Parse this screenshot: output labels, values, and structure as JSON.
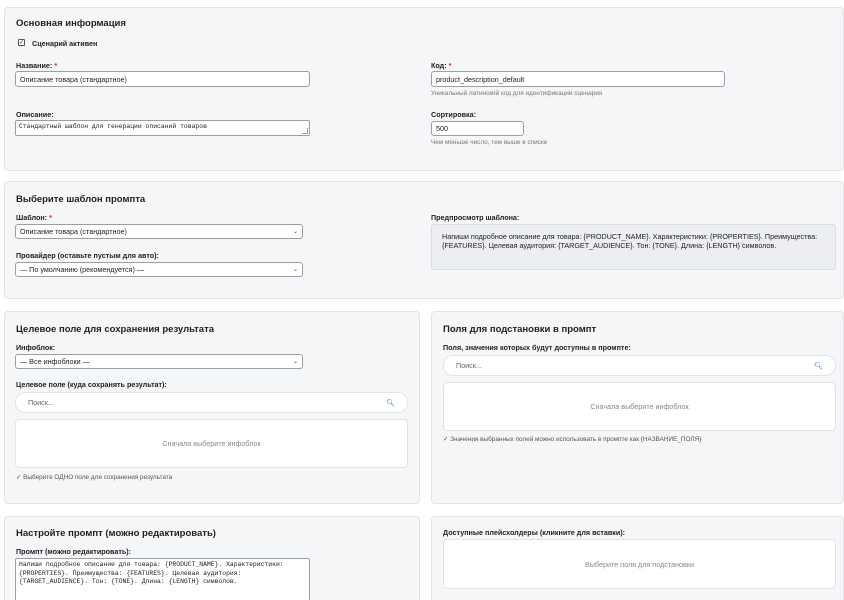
{
  "basic": {
    "title": "Основная информация",
    "active_checkbox": {
      "label": "Сценарий активен",
      "checked": true
    },
    "name": {
      "label": "Название:",
      "required": "*",
      "value": "Описание товара (стандартное)"
    },
    "code": {
      "label": "Код:",
      "required": "*",
      "value": "product_description_default",
      "hint": "Уникальный латинский код для идентификации сценария"
    },
    "description": {
      "label": "Описание:",
      "value": "Стандартный шаблон для генерации описаний товаров"
    },
    "sort": {
      "label": "Сортировка:",
      "value": "500",
      "hint": "Чем меньше число, тем выше в списке"
    }
  },
  "template": {
    "title": "Выберите шаблон промпта",
    "template_select": {
      "label": "Шаблон:",
      "required": "*",
      "value": "Описание товара (стандартное)"
    },
    "provider_select": {
      "label": "Провайдер (оставьте пустым для авто):",
      "value": "— По умолчанию (рекомендуется) —"
    },
    "preview": {
      "label": "Предпросмотр шаблона:",
      "text": "Напиши подробное описание для товара: {PRODUCT_NAME}. Характеристики: {PROPERTIES}. Преимущества: {FEATURES}. Целевая аудитория: {TARGET_AUDIENCE}. Тон: {TONE}. Длина: {LENGTH} символов."
    }
  },
  "target": {
    "title": "Целевое поле для сохранения результата",
    "iblock_select": {
      "label": "Инфоблок:",
      "value": "— Все инфоблоки —"
    },
    "field_label": "Целевое поле (куда сохранять результат):",
    "search_placeholder": "Поиск...",
    "empty_text": "Сначала выберите инфоблок",
    "note": "✓ Выберите ОДНО поле для сохранения результата"
  },
  "fields": {
    "title": "Поля для подстановки в промпт",
    "label": "Поля, значения которых будут доступны в промпте:",
    "search_placeholder": "Поиск...",
    "empty_text": "Сначала выберите инфоблок",
    "note": "✓ Значения выбранных полей можно использовать в промпте как {НАЗВАНИЕ_ПОЛЯ}"
  },
  "prompt": {
    "title": "Настройте промпт (можно редактировать)",
    "label": "Промпт (можно редактировать):",
    "text": "Напиши подробное описание для товара: {PRODUCT_NAME}. Характеристики: {PROPERTIES}. Преимущества: {FEATURES}. Целевая аудитория: {TARGET_AUDIENCE}. Тон: {TONE}. Длина: {LENGTH} символов."
  },
  "placeholders": {
    "label": "Доступные плейсхолдеры (кликните для вставки):",
    "empty_text": "Выберите поля для подстановки"
  },
  "icons": {
    "search": "search-icon",
    "check": "check-icon",
    "chevron": "chevron-down-icon"
  }
}
